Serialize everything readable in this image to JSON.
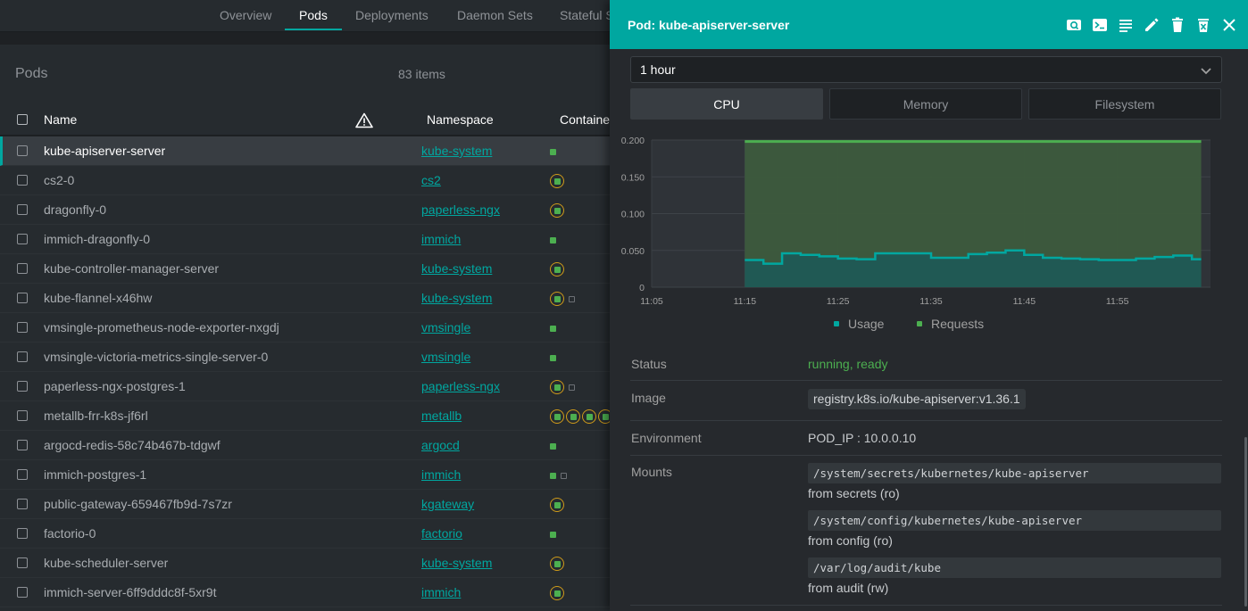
{
  "nav": {
    "tabs": [
      {
        "label": "Overview"
      },
      {
        "label": "Pods"
      },
      {
        "label": "Deployments"
      },
      {
        "label": "Daemon Sets"
      },
      {
        "label": "Stateful Sets"
      }
    ],
    "active_tab": "Pods"
  },
  "list": {
    "title": "Pods",
    "count": "83 items",
    "columns": {
      "name": "Name",
      "namespace": "Namespace",
      "containers": "Containers"
    },
    "warning_icon": "warning-icon",
    "rows": [
      {
        "name": "kube-apiserver-server",
        "namespace": "kube-system",
        "containers": [
          "dot"
        ],
        "selected": true
      },
      {
        "name": "cs2-0",
        "namespace": "cs2",
        "containers": [
          "ring"
        ]
      },
      {
        "name": "dragonfly-0",
        "namespace": "paperless-ngx",
        "containers": [
          "ring"
        ]
      },
      {
        "name": "immich-dragonfly-0",
        "namespace": "immich",
        "containers": [
          "dot"
        ]
      },
      {
        "name": "kube-controller-manager-server",
        "namespace": "kube-system",
        "containers": [
          "ring"
        ]
      },
      {
        "name": "kube-flannel-x46hw",
        "namespace": "kube-system",
        "containers": [
          "ring",
          "empty"
        ]
      },
      {
        "name": "vmsingle-prometheus-node-exporter-nxgdj",
        "namespace": "vmsingle",
        "containers": [
          "dot"
        ]
      },
      {
        "name": "vmsingle-victoria-metrics-single-server-0",
        "namespace": "vmsingle",
        "containers": [
          "dot"
        ]
      },
      {
        "name": "paperless-ngx-postgres-1",
        "namespace": "paperless-ngx",
        "containers": [
          "ring",
          "empty"
        ]
      },
      {
        "name": "metallb-frr-k8s-jf6rl",
        "namespace": "metallb",
        "containers": [
          "ring",
          "ring",
          "ring",
          "ring",
          "ring"
        ]
      },
      {
        "name": "argocd-redis-58c74b467b-tdgwf",
        "namespace": "argocd",
        "containers": [
          "dot"
        ]
      },
      {
        "name": "immich-postgres-1",
        "namespace": "immich",
        "containers": [
          "dot",
          "empty"
        ]
      },
      {
        "name": "public-gateway-659467fb9d-7s7zr",
        "namespace": "kgateway",
        "containers": [
          "ring"
        ]
      },
      {
        "name": "factorio-0",
        "namespace": "factorio",
        "containers": [
          "dot"
        ]
      },
      {
        "name": "kube-scheduler-server",
        "namespace": "kube-system",
        "containers": [
          "ring"
        ]
      },
      {
        "name": "immich-server-6ff9dddc8f-5xr9t",
        "namespace": "immich",
        "containers": [
          "ring"
        ]
      }
    ]
  },
  "drawer": {
    "title": "Pod: kube-apiserver-server",
    "toolbar_icons": [
      "search-logs-icon",
      "terminal-icon",
      "logs-icon",
      "edit-icon",
      "delete-icon",
      "evict-icon",
      "close-icon"
    ],
    "range": "1 hour",
    "metric_tabs": [
      "CPU",
      "Memory",
      "Filesystem"
    ],
    "active_metric": "CPU",
    "legend": {
      "usage": "Usage",
      "requests": "Requests"
    },
    "colors": {
      "accent": "#00a7a0",
      "usage": "#00a7a0",
      "requests": "#4caf50",
      "warning": "#ce9a1a"
    },
    "details": {
      "status_label": "Status",
      "status_value": "running, ready",
      "image_label": "Image",
      "image_value": "registry.k8s.io/kube-apiserver:v1.36.1",
      "env_label": "Environment",
      "env_value": "POD_IP : 10.0.0.10",
      "mounts_label": "Mounts",
      "mounts": [
        {
          "path": "/system/secrets/kubernetes/kube-apiserver",
          "from": "from secrets (ro)"
        },
        {
          "path": "/system/config/kubernetes/kube-apiserver",
          "from": "from config (ro)"
        },
        {
          "path": "/var/log/audit/kube",
          "from": "from audit (rw)"
        }
      ]
    }
  },
  "chart_data": {
    "type": "area",
    "title": "",
    "xlabel": "",
    "ylabel": "",
    "x_ticks": [
      "11:05",
      "11:15",
      "11:25",
      "11:35",
      "11:45",
      "11:55"
    ],
    "y_ticks": [
      "0",
      "0.050",
      "0.100",
      "0.150",
      "0.200"
    ],
    "ylim": [
      0,
      0.2
    ],
    "x_start": "11:05",
    "x_end": "12:05",
    "grid": true,
    "legend_position": "bottom",
    "series": [
      {
        "name": "Usage",
        "color": "#00a7a0",
        "x": [
          "11:15",
          "11:17",
          "11:19",
          "11:21",
          "11:23",
          "11:25",
          "11:27",
          "11:29",
          "11:31",
          "11:33",
          "11:35",
          "11:37",
          "11:39",
          "11:41",
          "11:43",
          "11:45",
          "11:47",
          "11:49",
          "11:51",
          "11:53",
          "11:55",
          "11:57",
          "11:59",
          "12:01",
          "12:03"
        ],
        "values": [
          0.037,
          0.032,
          0.046,
          0.044,
          0.042,
          0.039,
          0.038,
          0.046,
          0.046,
          0.046,
          0.04,
          0.04,
          0.045,
          0.047,
          0.05,
          0.044,
          0.04,
          0.039,
          0.038,
          0.037,
          0.037,
          0.039,
          0.041,
          0.043,
          0.038
        ]
      },
      {
        "name": "Requests",
        "color": "#4caf50",
        "x": [
          "11:15",
          "12:04"
        ],
        "values": [
          0.198,
          0.198
        ]
      }
    ]
  }
}
